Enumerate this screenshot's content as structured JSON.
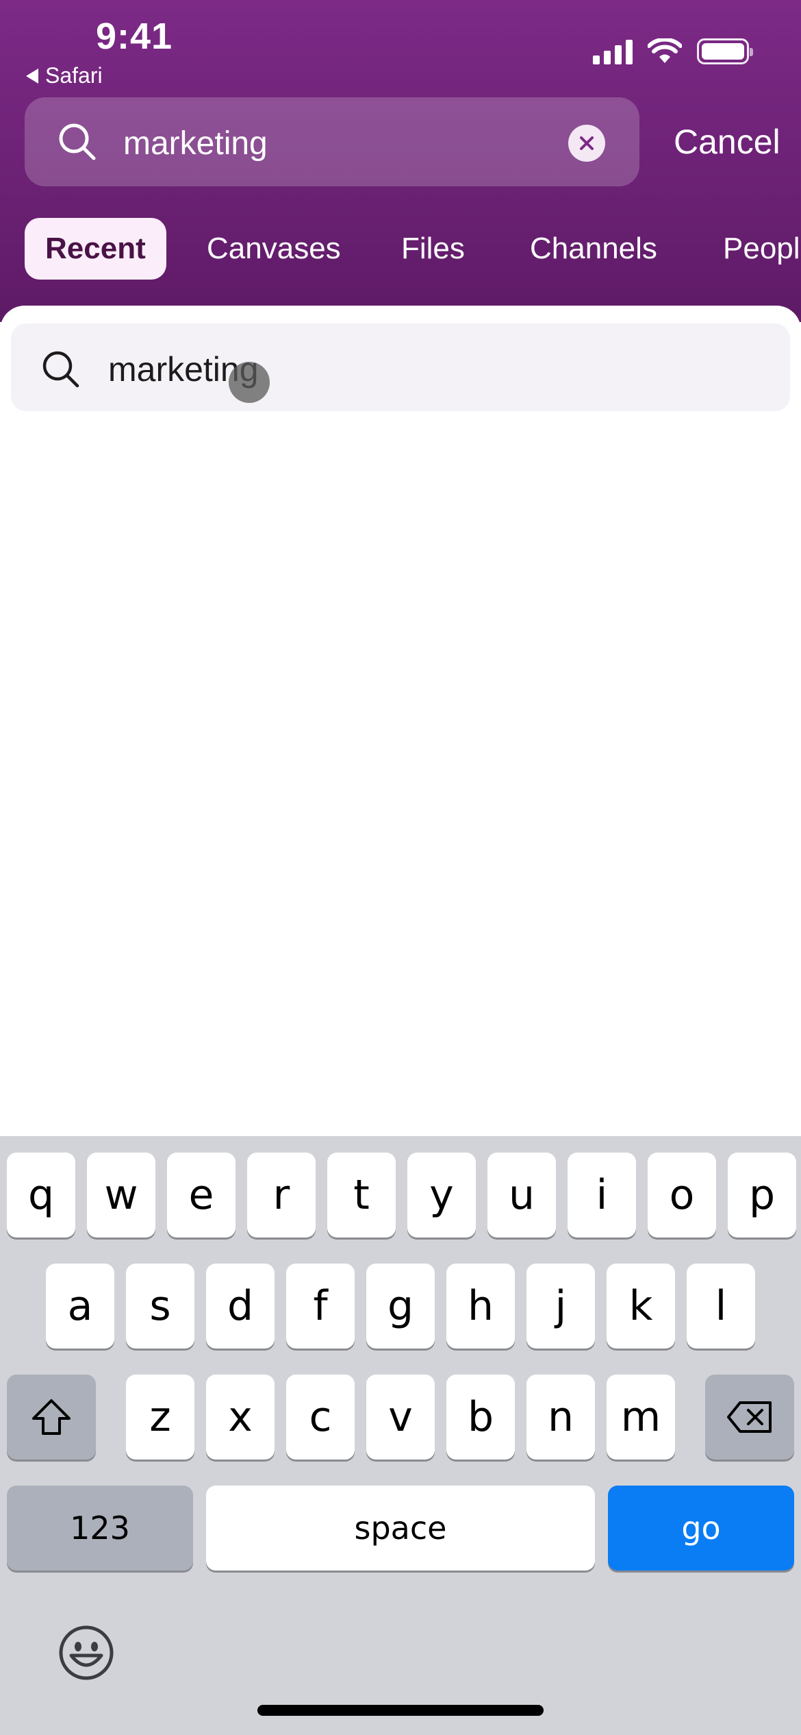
{
  "status_bar": {
    "time": "9:41",
    "back_app": "Safari"
  },
  "search": {
    "query": "marketing",
    "cancel_label": "Cancel"
  },
  "tabs": [
    {
      "label": "Recent",
      "active": true
    },
    {
      "label": "Canvases",
      "active": false
    },
    {
      "label": "Files",
      "active": false
    },
    {
      "label": "Channels",
      "active": false
    },
    {
      "label": "People",
      "active": false
    }
  ],
  "suggestion": {
    "text": "marketing"
  },
  "keyboard": {
    "row1": [
      "q",
      "w",
      "e",
      "r",
      "t",
      "y",
      "u",
      "i",
      "o",
      "p"
    ],
    "row2": [
      "a",
      "s",
      "d",
      "f",
      "g",
      "h",
      "j",
      "k",
      "l"
    ],
    "row3": [
      "z",
      "x",
      "c",
      "v",
      "b",
      "n",
      "m"
    ],
    "numbers_label": "123",
    "space_label": "space",
    "go_label": "go"
  },
  "colors": {
    "header_purple": "#6f2378",
    "active_tab_bg": "#fbeefa",
    "go_blue": "#0a7cf4",
    "keyboard_bg": "#d2d3d8"
  }
}
